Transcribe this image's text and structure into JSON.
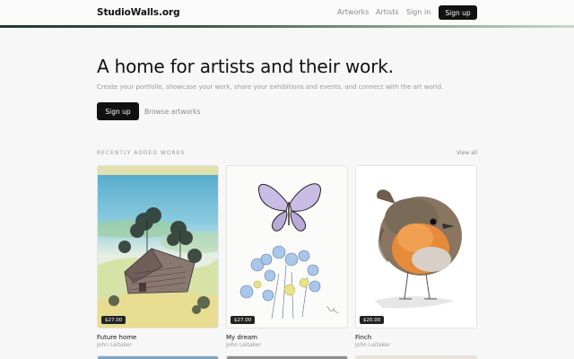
{
  "header": {
    "logo": "StudioWalls.org",
    "nav": {
      "artworks": "Artworks",
      "artists": "Artists",
      "sign_in": "Sign in",
      "sign_up": "Sign up"
    }
  },
  "hero": {
    "title": "A home for artists and their work.",
    "subtitle": "Create your portfolio, showcase your work, share your exhibitions and events, and connect with the art world.",
    "signup_label": "Sign up",
    "browse_label": "Browse artworks"
  },
  "recent": {
    "section_title": "RECENTLY ADDED WORKS",
    "view_all": "View all",
    "works": [
      {
        "title": "Future home",
        "artist": "John Leitaker",
        "price": "$27.00",
        "image": "watercolor-landscape-cottage"
      },
      {
        "title": "My dream",
        "artist": "John Leitaker",
        "price": "$27.00",
        "image": "watercolor-butterfly-flowers"
      },
      {
        "title": "Finch",
        "artist": "John Leitaker",
        "price": "$20.00",
        "image": "watercolor-robin-bird"
      }
    ]
  }
}
